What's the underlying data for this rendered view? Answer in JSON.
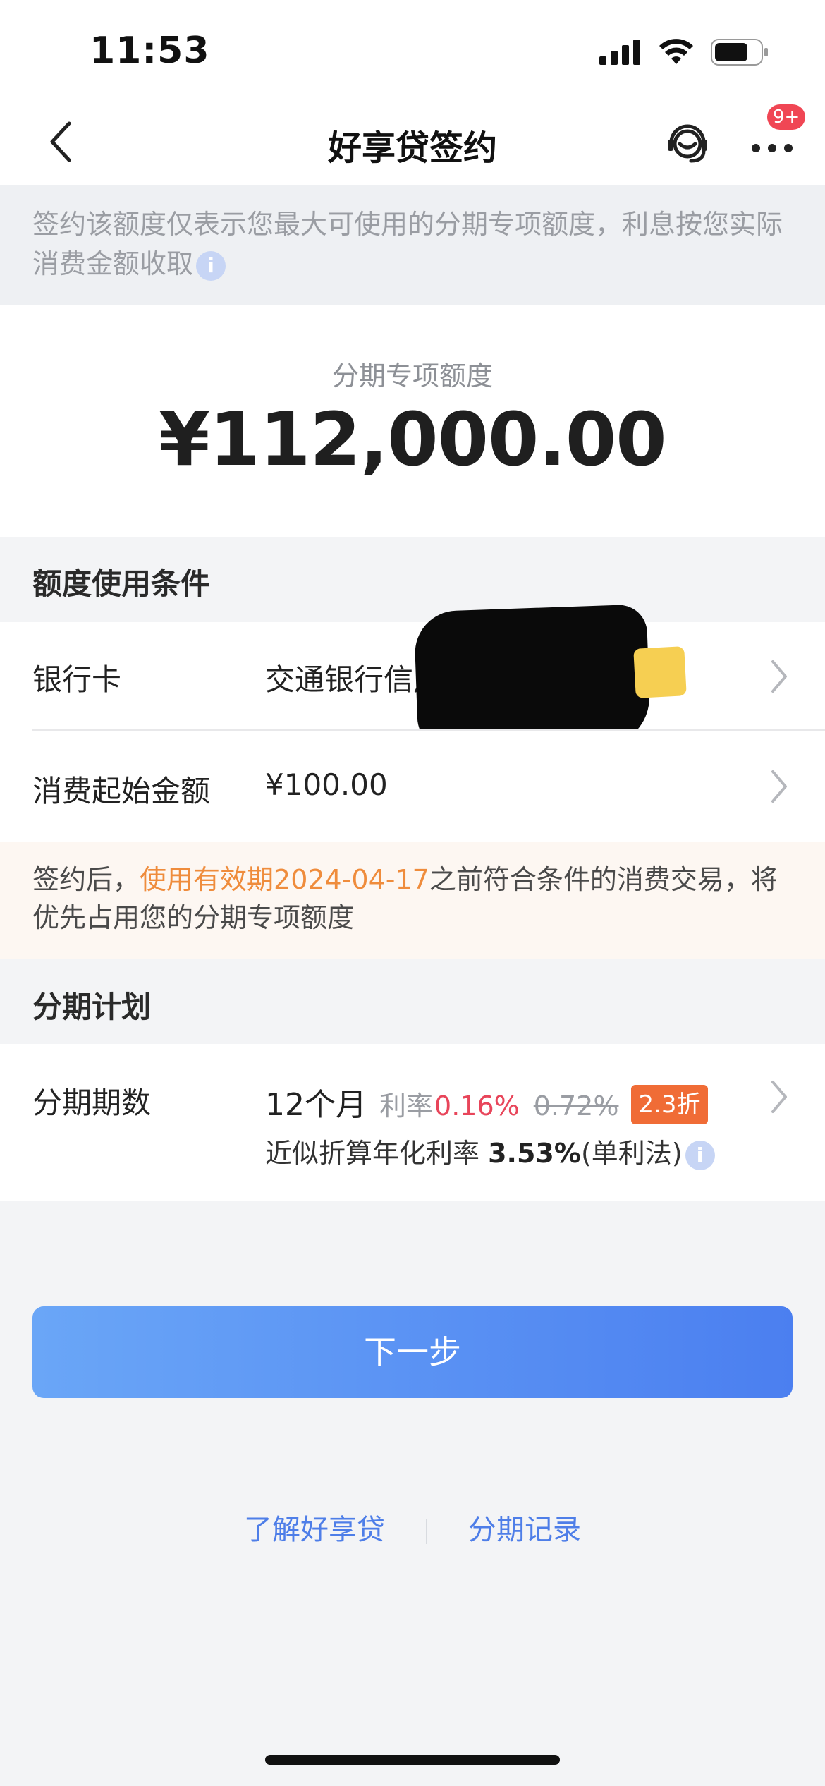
{
  "status_bar": {
    "time": "11:53"
  },
  "nav": {
    "title": "好享贷签约",
    "badge": "9+"
  },
  "notice": {
    "text": "签约该额度仅表示您最大可使用的分期专项额度，利息按您实际消费金额收取",
    "info_glyph": "i"
  },
  "amount": {
    "label": "分期专项额度",
    "value": "¥112,000.00"
  },
  "conditions": {
    "header": "额度使用条件",
    "bank_card_label": "银行卡",
    "bank_card_value": "交通银行信用",
    "min_amount_label": "消费起始金额",
    "min_amount_value": "¥100.00"
  },
  "tip": {
    "prefix": "签约后，",
    "highlight": "使用有效期2024-04-17",
    "suffix": "之前符合条件的消费交易，将优先占用您的分期专项额度"
  },
  "plan": {
    "header": "分期计划",
    "label": "分期期数",
    "months": "12个月",
    "rate_label": "利率",
    "rate_now": "0.16%",
    "rate_old": "0.72%",
    "discount": "2.3折",
    "annual_prefix": "近似折算年化利率 ",
    "annual_value": "3.53%",
    "annual_suffix": "(单利法)",
    "info_glyph": "i"
  },
  "actions": {
    "next_label": "下一步"
  },
  "footer": {
    "learn_label": "了解好享贷",
    "records_label": "分期记录"
  },
  "colors": {
    "accent_blue": "#4b7ff0",
    "highlight_orange": "#ef8c3c",
    "rate_red": "#e8455a",
    "discount_orange": "#f06c36",
    "badge_red": "#f04654"
  }
}
